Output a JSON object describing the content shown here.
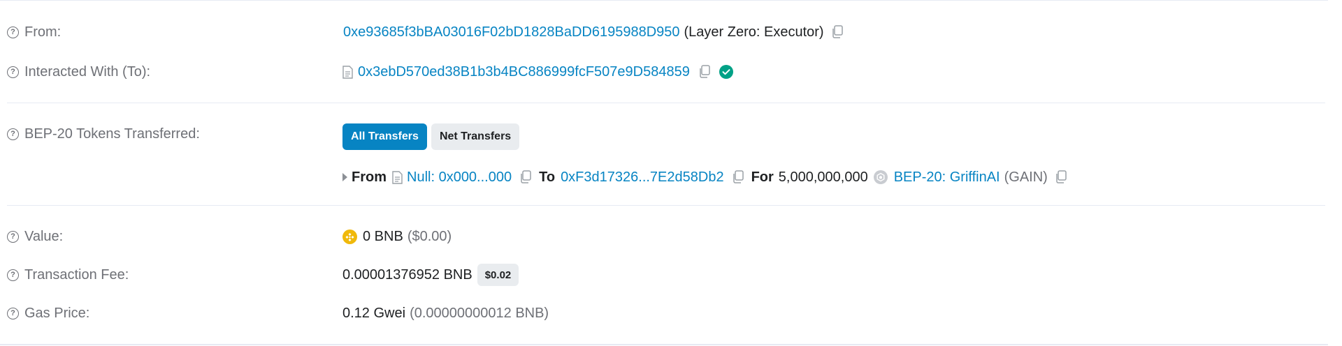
{
  "from": {
    "label": "From:",
    "address": "0xe93685f3bBA03016F02bD1828BaDD6195988D950",
    "name_tag": "(Layer Zero: Executor)"
  },
  "interacted": {
    "label": "Interacted With (To):",
    "address": "0x3ebD570ed38B1b3b4BC886999fcF507e9D584859"
  },
  "tokens": {
    "label": "BEP-20 Tokens Transferred:",
    "tabs": [
      "All Transfers",
      "Net Transfers"
    ],
    "transfer": {
      "from_word": "From",
      "from_address": "Null: 0x000...000",
      "to_word": "To",
      "to_address": "0xF3d17326...7E2d58Db2",
      "for_word": "For",
      "amount": "5,000,000,000",
      "token_name": "BEP-20: GriffinAI",
      "token_symbol": "(GAIN)"
    }
  },
  "value": {
    "label": "Value:",
    "amount": "0 BNB",
    "usd": "($0.00)"
  },
  "fee": {
    "label": "Transaction Fee:",
    "amount": "0.00001376952 BNB",
    "usd_badge": "$0.02"
  },
  "gas": {
    "label": "Gas Price:",
    "gwei": "0.12 Gwei",
    "bnb": "(0.00000000012 BNB)"
  },
  "icons": {
    "help": "question-circle-icon",
    "copy": "copy-icon",
    "contract": "file-document-icon",
    "verified": "check-circle-icon",
    "bnb": "bnb-coin-icon",
    "token": "token-logo-icon",
    "expand": "caret-right-icon"
  },
  "colors": {
    "link": "#0784c3",
    "primary_button": "#0784c3",
    "verified": "#00a186",
    "bnb": "#f0b90b",
    "muted": "#6e7076"
  }
}
